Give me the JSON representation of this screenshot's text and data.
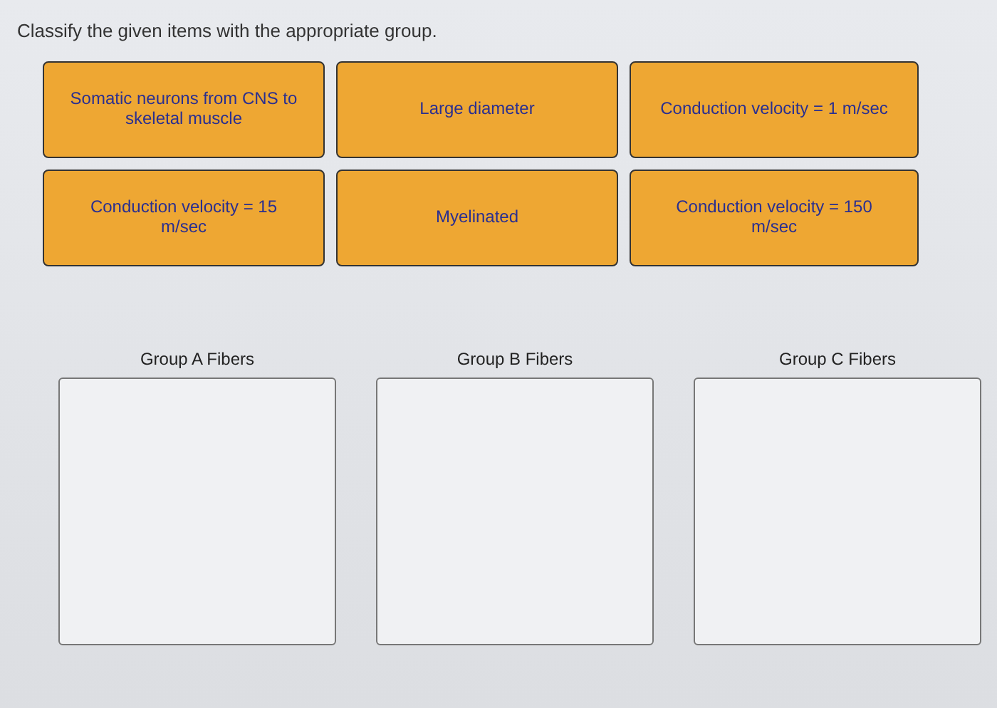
{
  "instruction": "Classify the given items with the appropriate group.",
  "items": [
    {
      "label": "Somatic neurons from CNS to skeletal muscle"
    },
    {
      "label": "Large diameter"
    },
    {
      "label": "Conduction velocity = 1 m/sec"
    },
    {
      "label": "Conduction velocity = 15 m/sec"
    },
    {
      "label": "Myelinated"
    },
    {
      "label": "Conduction velocity = 150 m/sec"
    }
  ],
  "groups": [
    {
      "title": "Group A Fibers"
    },
    {
      "title": "Group B Fibers"
    },
    {
      "title": "Group C Fibers"
    }
  ]
}
